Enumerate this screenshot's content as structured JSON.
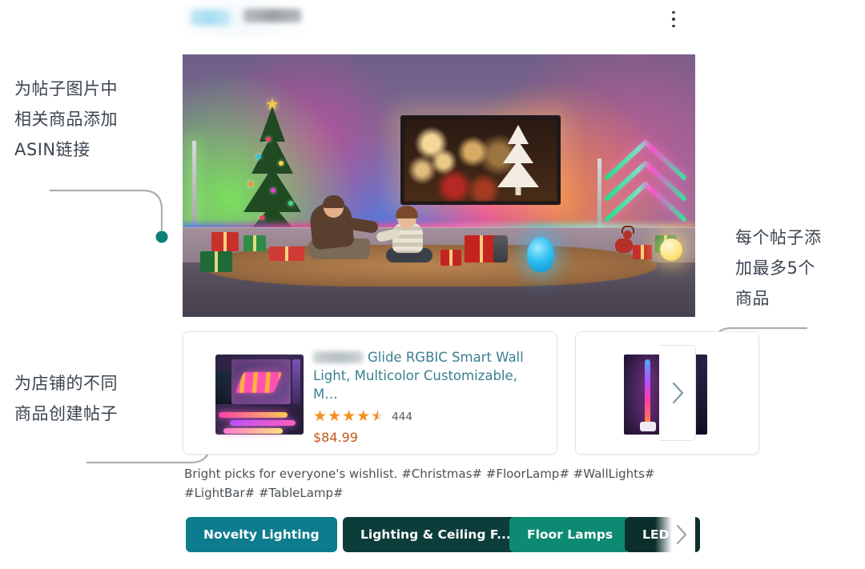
{
  "annotations": [
    {
      "id": "asin",
      "text": "为帖子图片中\n相关商品添加\nASIN链接"
    },
    {
      "id": "create",
      "text": "为店铺的不同\n商品创建帖子"
    },
    {
      "id": "max5",
      "text": "每个帖子添\n加最多5个\n商品"
    }
  ],
  "post": {
    "header": {
      "brand_logo_label": "brand-logo-redacted",
      "brand_name_label": "brand-name-redacted",
      "more_menu_label": "More options"
    },
    "hero": {
      "alt": "Living room decorated with RGB smart lights, Christmas tree, TV and family opening gifts"
    },
    "products": [
      {
        "brand_redacted": true,
        "title": "Glide RGBIC Smart Wall Light, Multicolor Customizable, M…",
        "rating": 4.5,
        "rating_stars_glyph": "★★★★★",
        "review_count": "444",
        "price": "$84.99"
      },
      {
        "brand_redacted": true,
        "title": "",
        "rating": null,
        "review_count": "",
        "price": ""
      }
    ],
    "next_products_label": "Next products",
    "caption": "Bright picks for everyone's wishlist. #Christmas# #FloorLamp# #WallLights# #LightBar# #TableLamp#",
    "chips": [
      {
        "label": "Novelty Lighting",
        "color": "#0d7c8e"
      },
      {
        "label": "Lighting & Ceiling F...",
        "color": "#0c3d3b"
      },
      {
        "label": "Floor Lamps",
        "color": "#0d8a72"
      },
      {
        "label": "LED S",
        "color": "#0c2f2c"
      }
    ],
    "chips_next_label": "Next categories"
  },
  "colors": {
    "accent_dot": "#0d8276",
    "leader_line": "#a9b0b4",
    "title_link": "#3a7f90",
    "price": "#c4551d",
    "star": "#f19021",
    "annotation_text": "#3c4650"
  }
}
